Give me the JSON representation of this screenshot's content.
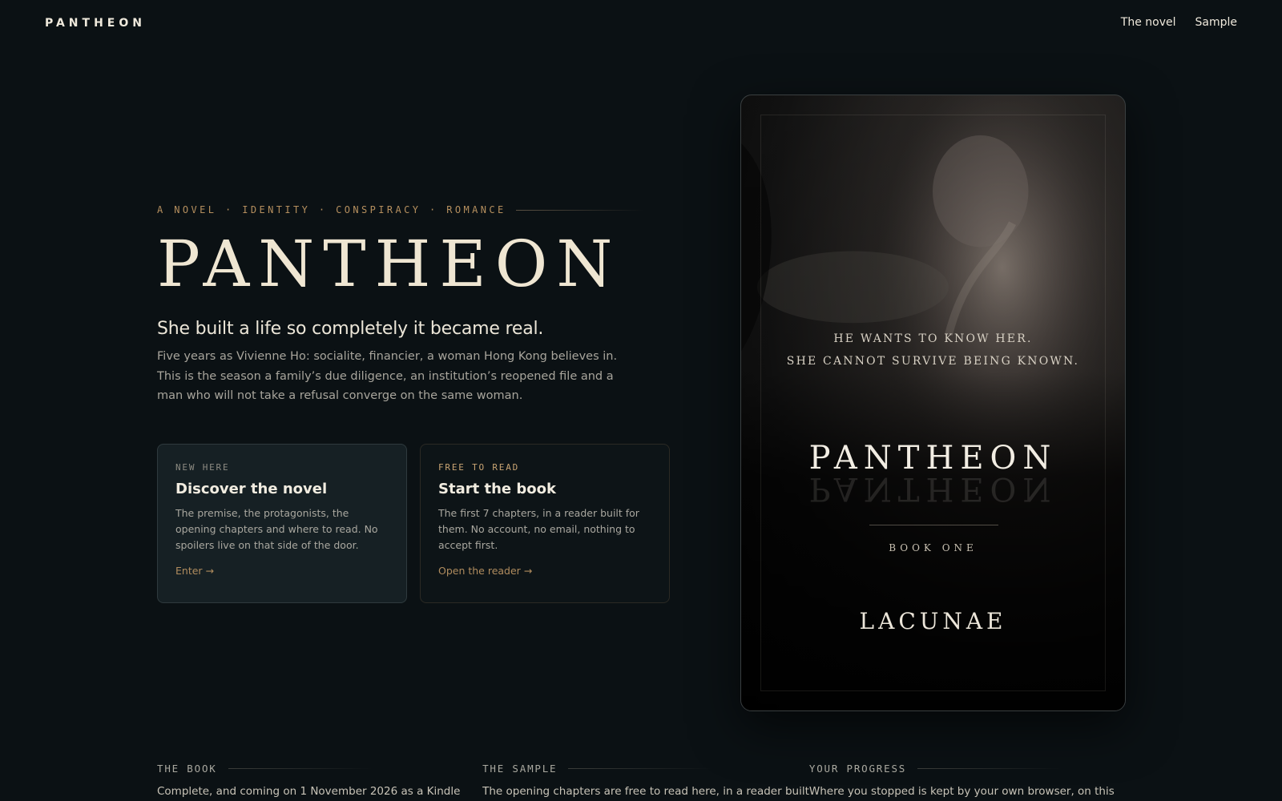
{
  "header": {
    "brand": "PANTHEON",
    "nav": [
      "The novel",
      "Sample"
    ]
  },
  "hero": {
    "eyebrow": "A NOVEL · IDENTITY · CONSPIRACY · ROMANCE",
    "title": "PANTHEON",
    "tagline": "She built a life so completely it became real.",
    "blurb": "Five years as Vivienne Ho: socialite, financier, a woman Hong Kong believes in. This is the season a family’s due diligence, an institution’s reopened file and a man who will not take a refusal converge on the same woman."
  },
  "cards": [
    {
      "kicker": "NEW HERE",
      "title": "Discover the novel",
      "text": "The premise, the protagonists, the opening chapters and where to read. No spoilers live on that side of the door.",
      "link": "Enter →"
    },
    {
      "kicker": "FREE TO READ",
      "title": "Start the book",
      "text": "The first 7 chapters, in a reader built for them. No account, no email, nothing to accept first.",
      "link": "Open the reader →"
    }
  ],
  "cover": {
    "quote_line1": "HE WANTS TO KNOW HER.",
    "quote_line2": "SHE CANNOT SURVIVE BEING KNOWN.",
    "title": "PANTHEON",
    "series": "BOOK ONE",
    "author": "LACUNAE"
  },
  "sections": [
    {
      "label": "THE BOOK",
      "text": "Complete, and coming on 1 November 2026 as a Kindle"
    },
    {
      "label": "THE SAMPLE",
      "text": "The opening chapters are free to read here, in a reader built"
    },
    {
      "label": "YOUR PROGRESS",
      "text": "Where you stopped is kept by your own browser, on this"
    }
  ],
  "colors": {
    "background": "#0b1114",
    "accent": "#b58f5e",
    "text": "#efe6d2"
  }
}
